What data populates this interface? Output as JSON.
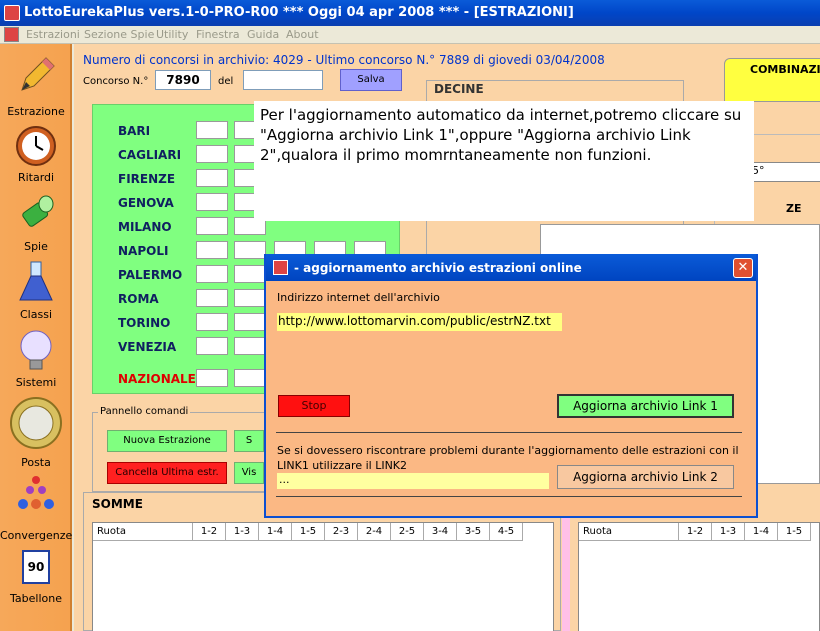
{
  "window": {
    "title": "LottoEurekaPlus vers.1-0-PRO-R00  ***  Oggi 04 apr 2008  ***   - [ESTRAZIONI]"
  },
  "menu": [
    "Estrazioni",
    "Sezione Spie",
    "Utility",
    "Finestra",
    "Guida",
    "About"
  ],
  "sidebar": [
    {
      "label": "Estrazione",
      "icon": "pencil-icon"
    },
    {
      "label": "Ritardi",
      "icon": "clock-icon"
    },
    {
      "label": "Spie",
      "icon": "flashlight-icon"
    },
    {
      "label": "Classi",
      "icon": "flask-icon"
    },
    {
      "label": "Sistemi",
      "icon": "lightbulb-icon"
    },
    {
      "label": "Posta",
      "icon": "euro-coin-icon"
    },
    {
      "label": "Convergenze",
      "icon": "balls-icon"
    },
    {
      "label": "Tabellone",
      "icon": "tabellone-icon",
      "badge": "90"
    }
  ],
  "header": {
    "info": "Numero di concorsi in archivio: 4029   -   Ultimo concorso N.° 7889   di giovedi 03/04/2008",
    "concorso_label": "Concorso N.°",
    "concorso_value": "7890",
    "del_label": "del",
    "salva_label": "Salva"
  },
  "decine_label": "DECINE",
  "combinazio_label": "COMBINAZIO",
  "right_col_label": "5°",
  "right_ze_label": "ZE",
  "ruote": [
    "BARI",
    "CAGLIARI",
    "FIRENZE",
    "GENOVA",
    "MILANO",
    "NAPOLI",
    "PALERMO",
    "ROMA",
    "TORINO",
    "VENEZIA"
  ],
  "nazionale_label": "NAZIONALE",
  "pannello": {
    "label": "Pannello comandi",
    "nuova": "Nuova Estrazione",
    "cancella": "Cancella Ultima estr.",
    "s_btn": "S",
    "vis_btn": "Vis"
  },
  "somme": {
    "label": "SOMME",
    "headers": [
      "Ruota",
      "1-2",
      "1-3",
      "1-4",
      "1-5",
      "2-3",
      "2-4",
      "2-5",
      "3-4",
      "3-5",
      "4-5"
    ],
    "headers_right": [
      "Ruota",
      "1-2",
      "1-3",
      "1-4",
      "1-5"
    ]
  },
  "tooltip": "Per l'aggiornamento automatico da internet,potremo cliccare su \"Aggiorna archivio Link 1\",oppure \"Aggiorna archivio Link 2\",qualora il primo momrntaneamente non funzioni.",
  "dialog": {
    "title": " - aggiornamento archivio estrazioni online",
    "address_label": "Indirizzo internet dell'archivio",
    "url": "http://www.lottomarvin.com/public/estrNZ.txt",
    "stop": "Stop",
    "link1": "Aggiorna archivio Link 1",
    "message": "Se si dovessero riscontrare problemi durante l'aggiornamento delle estrazioni con il LINK1 utilizzare il LINK2",
    "status": "...",
    "link2": "Aggiorna archivio Link 2",
    "close": "✕"
  }
}
